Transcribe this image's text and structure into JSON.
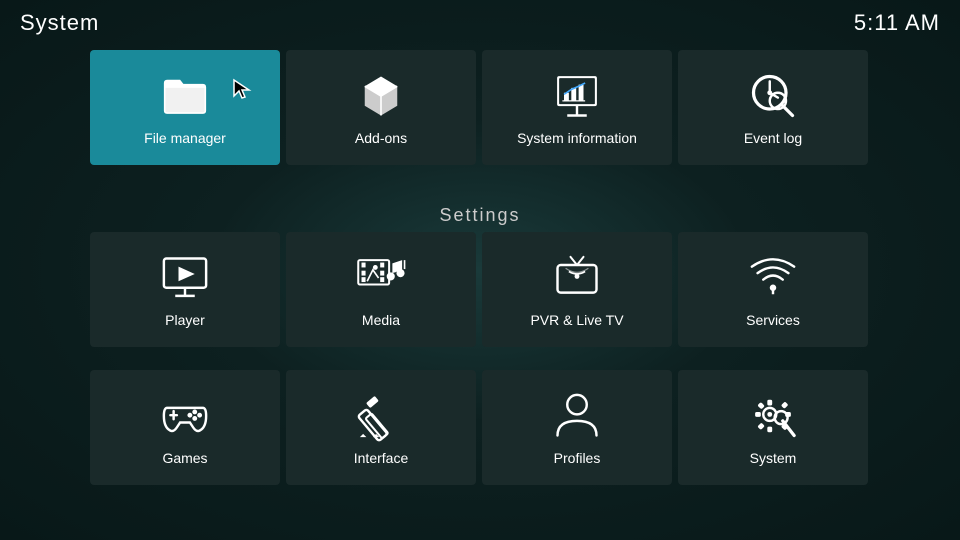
{
  "header": {
    "title": "System",
    "time": "5:11 AM"
  },
  "top_tiles": [
    {
      "id": "file-manager",
      "label": "File manager",
      "icon": "folder",
      "active": true
    },
    {
      "id": "add-ons",
      "label": "Add-ons",
      "icon": "addons"
    },
    {
      "id": "system-information",
      "label": "System information",
      "icon": "sysinfo"
    },
    {
      "id": "event-log",
      "label": "Event log",
      "icon": "eventlog"
    }
  ],
  "settings_label": "Settings",
  "grid_row1": [
    {
      "id": "player",
      "label": "Player",
      "icon": "player"
    },
    {
      "id": "media",
      "label": "Media",
      "icon": "media"
    },
    {
      "id": "pvr-live-tv",
      "label": "PVR & Live TV",
      "icon": "pvr"
    },
    {
      "id": "services",
      "label": "Services",
      "icon": "services"
    }
  ],
  "grid_row2": [
    {
      "id": "games",
      "label": "Games",
      "icon": "games"
    },
    {
      "id": "interface",
      "label": "Interface",
      "icon": "interface"
    },
    {
      "id": "profiles",
      "label": "Profiles",
      "icon": "profiles"
    },
    {
      "id": "system",
      "label": "System",
      "icon": "system"
    }
  ]
}
